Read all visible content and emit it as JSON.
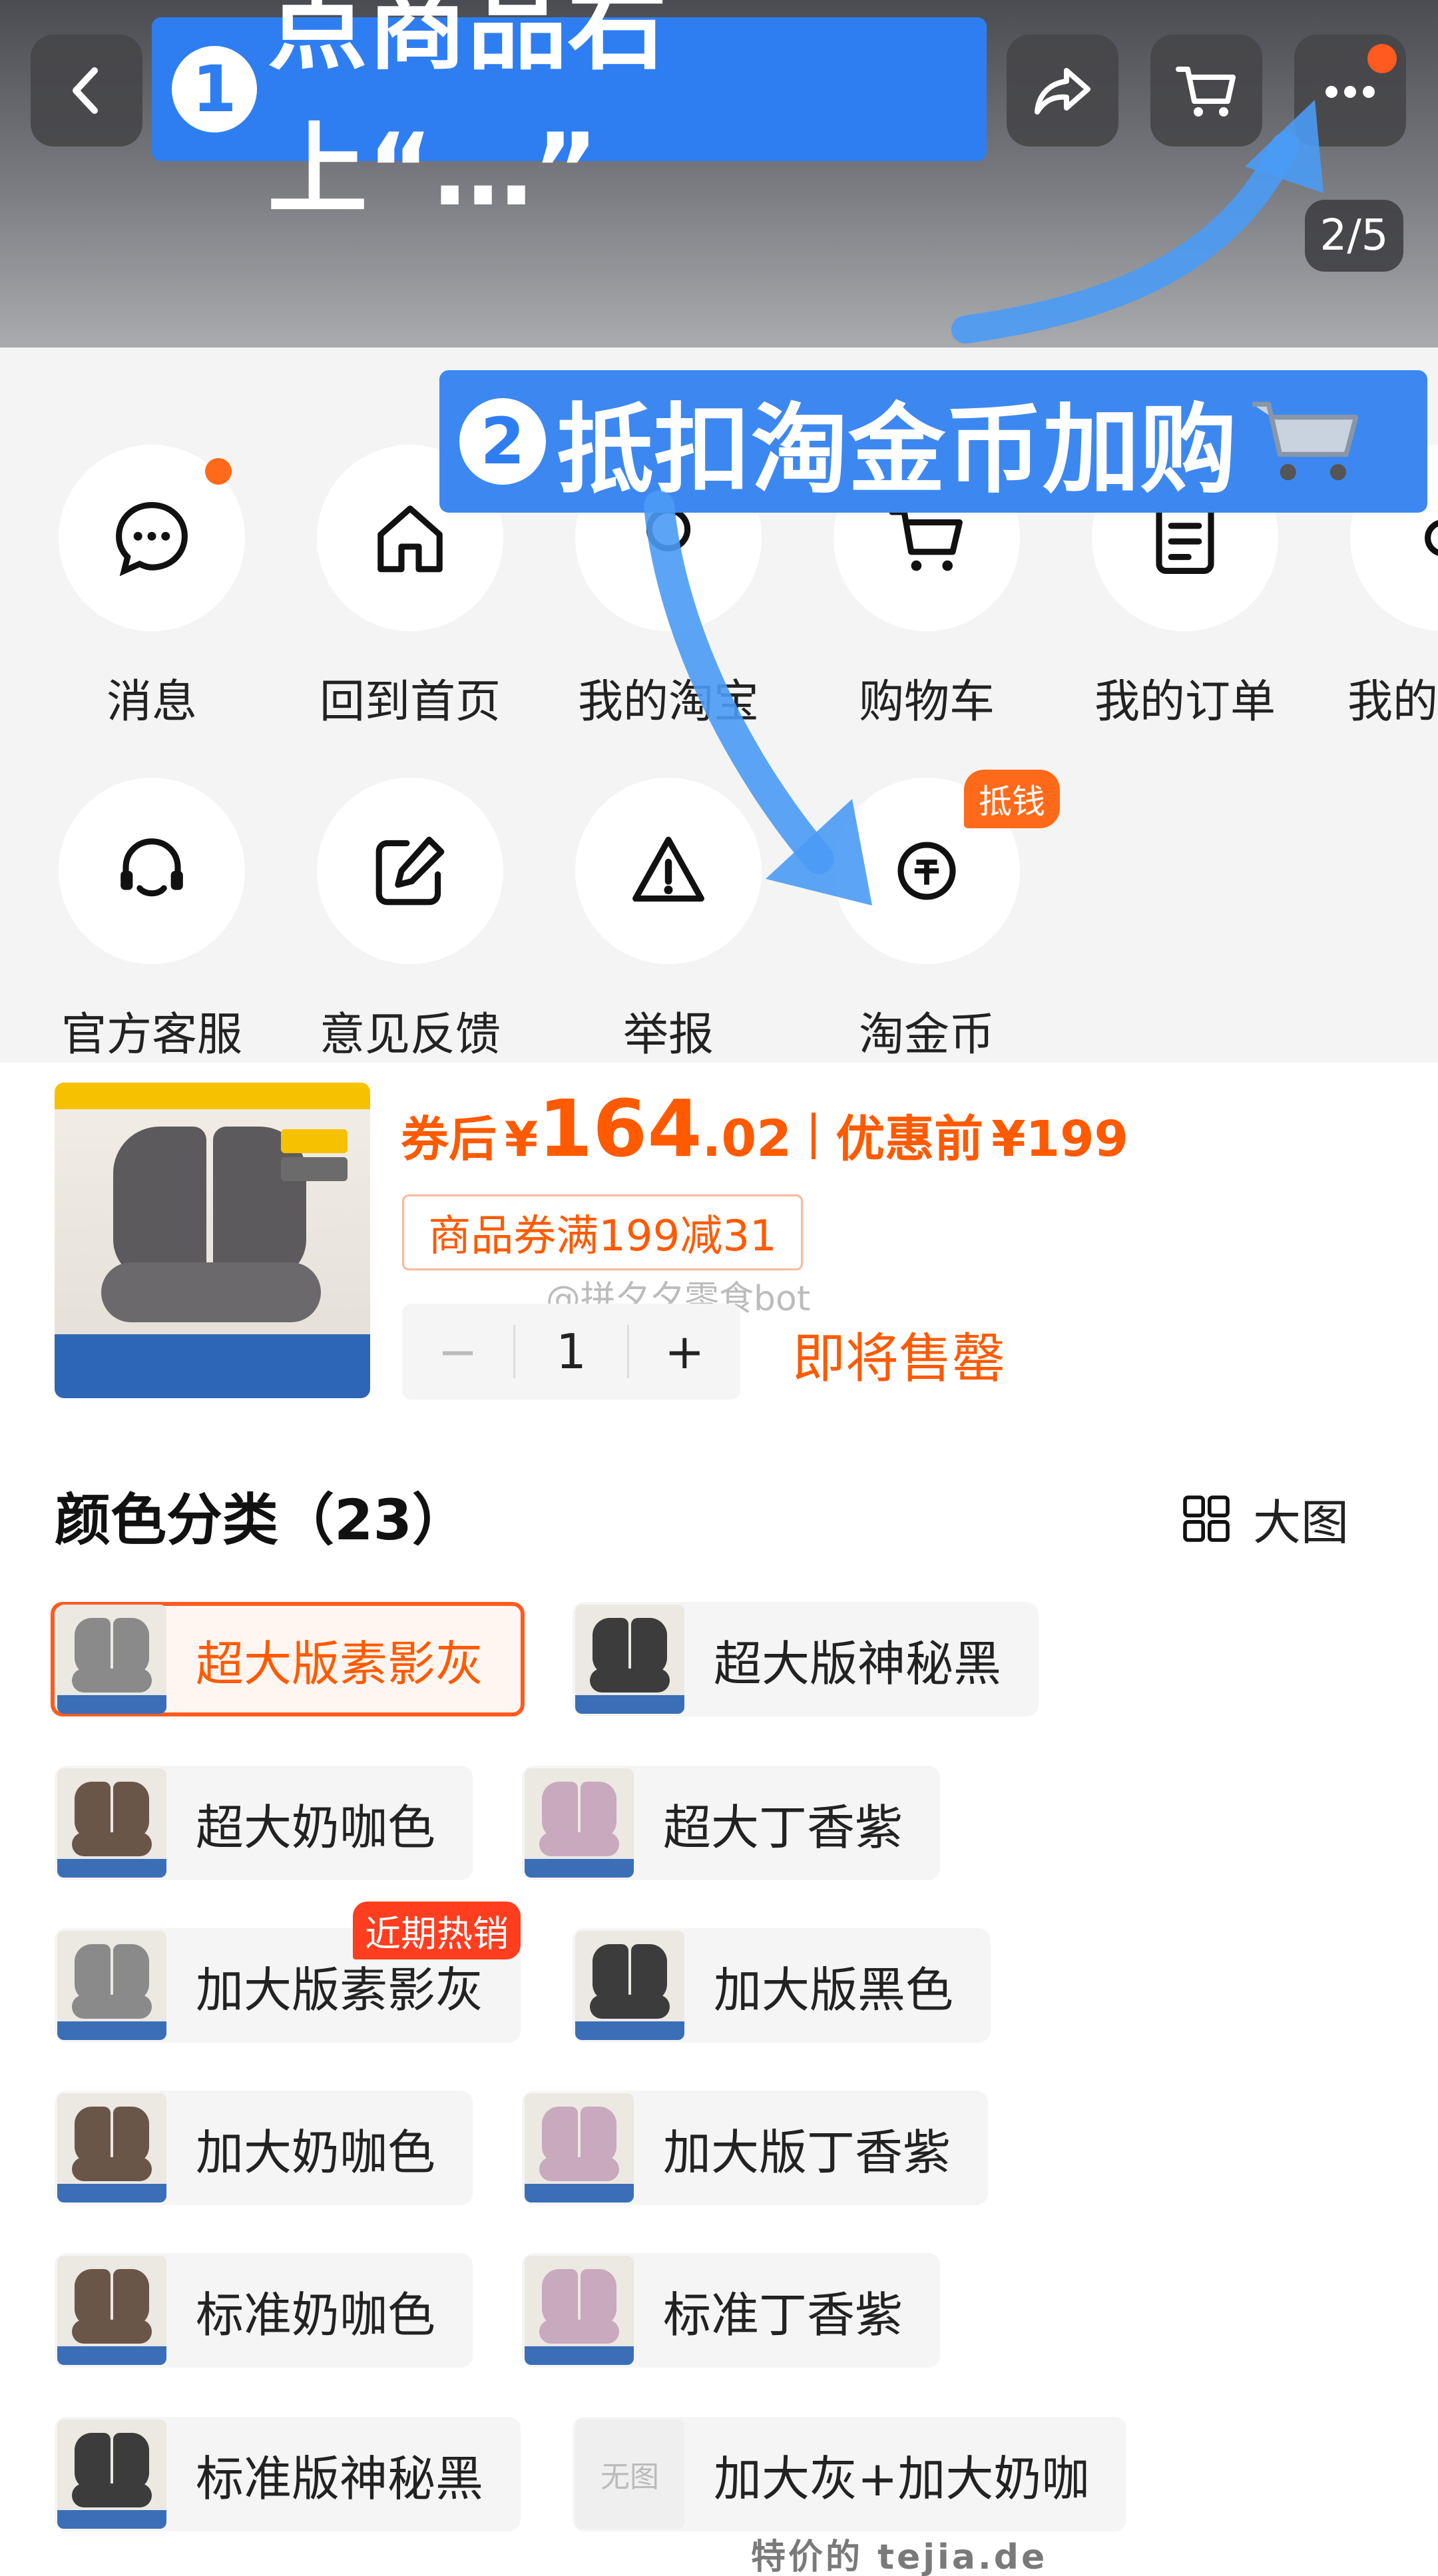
{
  "topbar": {
    "annotation1": "点商品右上“…”",
    "annotation1_num": "1",
    "page_indicator": "2/5"
  },
  "menu": {
    "annotation2": "抵扣淘金币加购",
    "annotation2_num": "2",
    "annotation2_icon": "shopping-cart-emoji",
    "row1": [
      "消息",
      "回到首页",
      "我的淘宝",
      "购物车",
      "我的订单",
      "我的"
    ],
    "row2": [
      "官方客服",
      "意见反馈",
      "举报",
      "淘金币"
    ],
    "badge": "抵钱"
  },
  "product": {
    "after_label": "券后",
    "currency": "¥",
    "price_int": "164",
    "price_dec": ".02",
    "before_label": "优惠前",
    "before_price": "¥199",
    "coupon": "商品券满199减31",
    "watermark": "@拼夕夕零食bot",
    "quantity": "1",
    "minus": "−",
    "plus": "+",
    "status": "即将售罄"
  },
  "colors": {
    "title": "颜色分类（23）",
    "big_image_label": "大图",
    "hot_badge": "近期热销",
    "no_image": "无图",
    "options": [
      {
        "label": "超大版素影灰",
        "swatch": "#8a8a8a"
      },
      {
        "label": "超大版神秘黑",
        "swatch": "#3c3c3c"
      },
      {
        "label": "超大奶咖色",
        "swatch": "#6a5648"
      },
      {
        "label": "超大丁香紫",
        "swatch": "#c9a9be"
      },
      {
        "label": "加大版素影灰",
        "swatch": "#8a8a8a"
      },
      {
        "label": "加大版黑色",
        "swatch": "#3c3c3c"
      },
      {
        "label": "加大奶咖色",
        "swatch": "#6a5648"
      },
      {
        "label": "加大版丁香紫",
        "swatch": "#c9a9be"
      },
      {
        "label": "标准奶咖色",
        "swatch": "#6a5648"
      },
      {
        "label": "标准丁香紫",
        "swatch": "#c9a9be"
      },
      {
        "label": "标准版神秘黑",
        "swatch": "#3c3c3c"
      },
      {
        "label": "加大灰+加大奶咖",
        "swatch": ""
      }
    ]
  },
  "footer": {
    "watermark": "特价的 tejia.de"
  },
  "theme": {
    "accent": "#ff5a00",
    "annotation_blue": "#2e7ef2"
  }
}
